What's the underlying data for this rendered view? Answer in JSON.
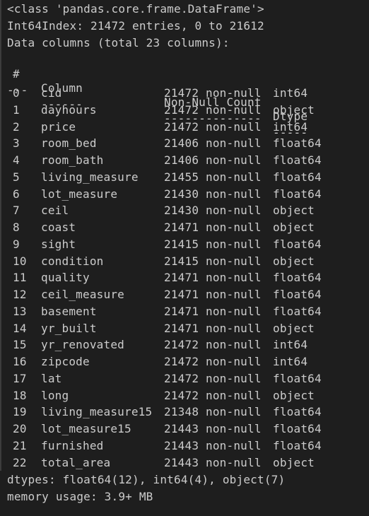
{
  "header": {
    "class_line": "<class 'pandas.core.frame.DataFrame'>",
    "index_line": "Int64Index: 21472 entries, 0 to 21612",
    "columns_line": "Data columns (total 23 columns):"
  },
  "table": {
    "headers": [
      "#",
      "Column",
      "Non-Null Count",
      "Dtype"
    ],
    "separators": [
      "---",
      "------",
      "--------------",
      "-----"
    ],
    "rows": [
      {
        "idx": "0",
        "col": "cid",
        "count": "21472 non-null",
        "dtype": "int64"
      },
      {
        "idx": "1",
        "col": "dayhours",
        "count": "21472 non-null",
        "dtype": "object"
      },
      {
        "idx": "2",
        "col": "price",
        "count": "21472 non-null",
        "dtype": "int64"
      },
      {
        "idx": "3",
        "col": "room_bed",
        "count": "21406 non-null",
        "dtype": "float64"
      },
      {
        "idx": "4",
        "col": "room_bath",
        "count": "21406 non-null",
        "dtype": "float64"
      },
      {
        "idx": "5",
        "col": "living_measure",
        "count": "21455 non-null",
        "dtype": "float64"
      },
      {
        "idx": "6",
        "col": "lot_measure",
        "count": "21430 non-null",
        "dtype": "float64"
      },
      {
        "idx": "7",
        "col": "ceil",
        "count": "21430 non-null",
        "dtype": "object"
      },
      {
        "idx": "8",
        "col": "coast",
        "count": "21471 non-null",
        "dtype": "object"
      },
      {
        "idx": "9",
        "col": "sight",
        "count": "21415 non-null",
        "dtype": "float64"
      },
      {
        "idx": "10",
        "col": "condition",
        "count": "21415 non-null",
        "dtype": "object"
      },
      {
        "idx": "11",
        "col": "quality",
        "count": "21471 non-null",
        "dtype": "float64"
      },
      {
        "idx": "12",
        "col": "ceil_measure",
        "count": "21471 non-null",
        "dtype": "float64"
      },
      {
        "idx": "13",
        "col": "basement",
        "count": "21471 non-null",
        "dtype": "float64"
      },
      {
        "idx": "14",
        "col": "yr_built",
        "count": "21471 non-null",
        "dtype": "object"
      },
      {
        "idx": "15",
        "col": "yr_renovated",
        "count": "21472 non-null",
        "dtype": "int64"
      },
      {
        "idx": "16",
        "col": "zipcode",
        "count": "21472 non-null",
        "dtype": "int64"
      },
      {
        "idx": "17",
        "col": "lat",
        "count": "21472 non-null",
        "dtype": "float64"
      },
      {
        "idx": "18",
        "col": "long",
        "count": "21472 non-null",
        "dtype": "object"
      },
      {
        "idx": "19",
        "col": "living_measure15",
        "count": "21348 non-null",
        "dtype": "float64"
      },
      {
        "idx": "20",
        "col": "lot_measure15",
        "count": "21443 non-null",
        "dtype": "float64"
      },
      {
        "idx": "21",
        "col": "furnished",
        "count": "21443 non-null",
        "dtype": "float64"
      },
      {
        "idx": "22",
        "col": "total_area",
        "count": "21443 non-null",
        "dtype": "object"
      }
    ]
  },
  "footer": {
    "dtypes_line": "dtypes: float64(12), int64(4), object(7)",
    "memory_line": "memory usage: 3.9+ MB"
  },
  "colors": {
    "background": "#1e1e1e",
    "text": "#cccccc",
    "cursor_bar": "#3c3c3c"
  }
}
